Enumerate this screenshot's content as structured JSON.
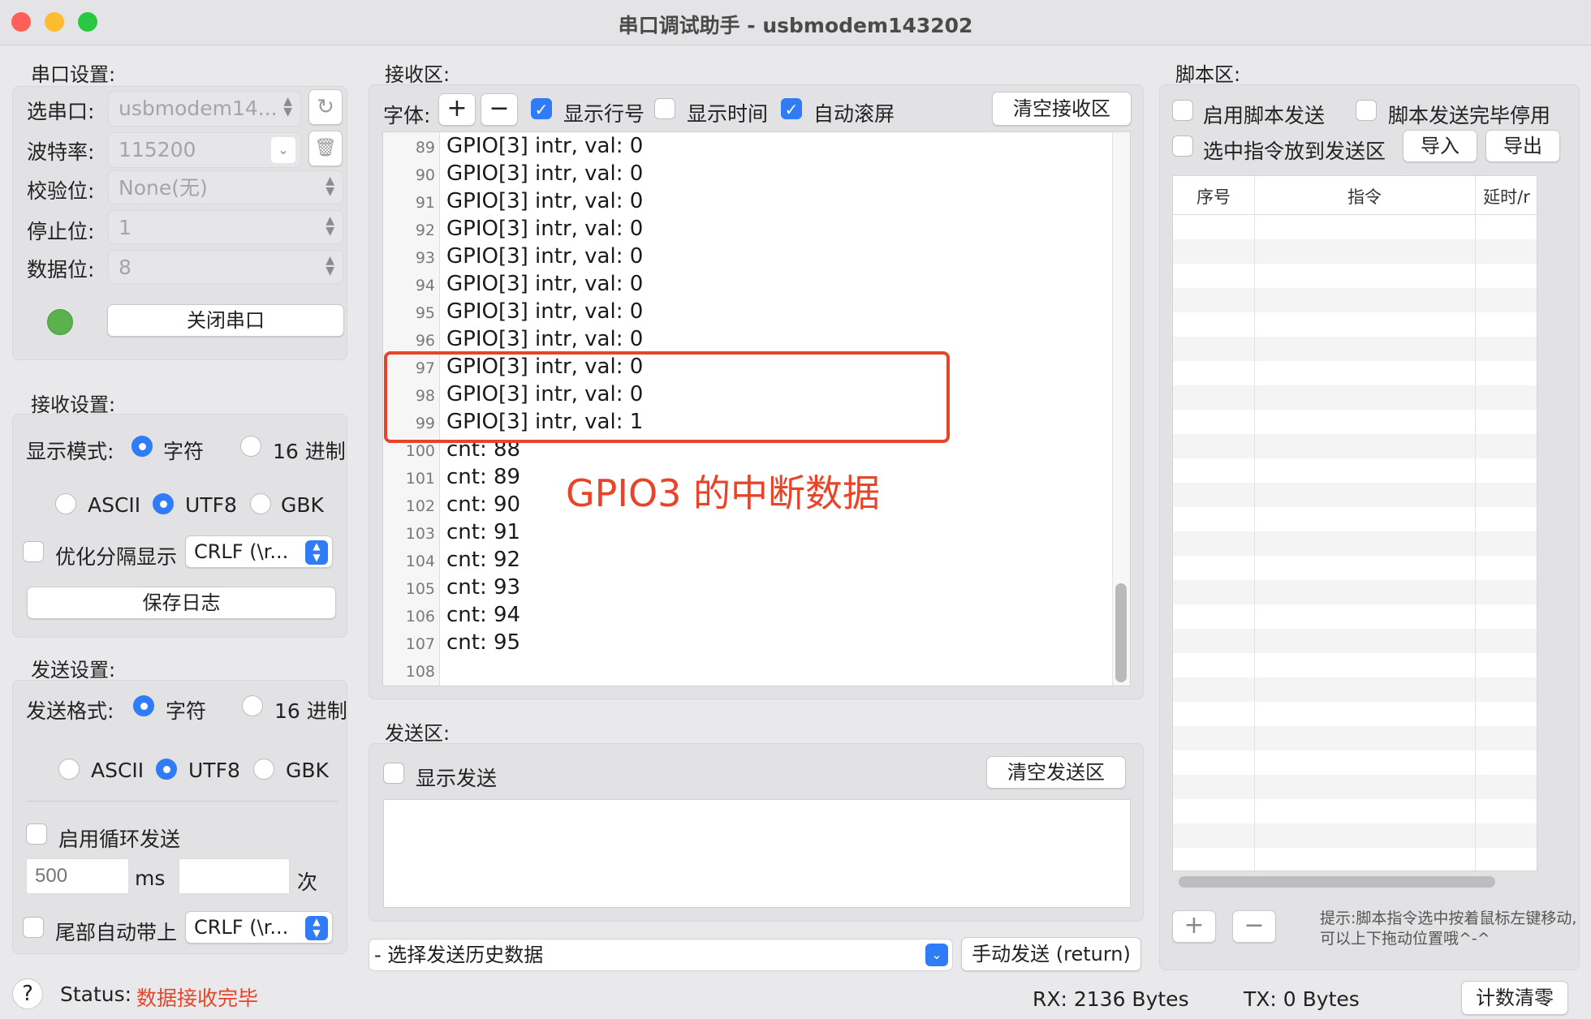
{
  "window": {
    "title": "串口调试助手 - usbmodem143202",
    "traffic_colors": {
      "close": "#fe5f57",
      "minimize": "#febc2e",
      "zoom": "#28c840"
    }
  },
  "serial_settings": {
    "title": "串口设置:",
    "port_label": "选串口:",
    "port_value": "usbmodem14...",
    "baud_label": "波特率:",
    "baud_value": "115200",
    "parity_label": "校验位:",
    "parity_value": "None(无)",
    "stop_label": "停止位:",
    "stop_value": "1",
    "data_label": "数据位:",
    "data_value": "8",
    "status_color": "#5bb14c",
    "toggle_button": "关闭串口"
  },
  "receive_settings": {
    "title": "接收设置:",
    "display_mode_label": "显示模式:",
    "mode_char": "字符",
    "mode_hex": "16 进制",
    "enc_ascii": "ASCII",
    "enc_utf8": "UTF8",
    "enc_gbk": "GBK",
    "optimize_label": "优化分隔显示",
    "line_ending": "CRLF (\\r...",
    "save_log": "保存日志"
  },
  "send_settings": {
    "title": "发送设置:",
    "format_label": "发送格式:",
    "mode_char": "字符",
    "mode_hex": "16 进制",
    "enc_ascii": "ASCII",
    "enc_utf8": "UTF8",
    "enc_gbk": "GBK",
    "loop_label": "启用循环发送",
    "interval_placeholder": "500",
    "interval_unit": "ms",
    "count_unit": "次",
    "tail_label": "尾部自动带上",
    "line_ending": "CRLF (\\r..."
  },
  "receive_area": {
    "title": "接收区:",
    "font_label": "字体:",
    "font_plus": "+",
    "font_minus": "−",
    "show_line_numbers": "显示行号",
    "show_time": "显示时间",
    "auto_scroll": "自动滚屏",
    "clear_button": "清空接收区",
    "lines": [
      {
        "n": "89",
        "t": "GPIO[3] intr, val: 0"
      },
      {
        "n": "90",
        "t": "GPIO[3] intr, val: 0"
      },
      {
        "n": "91",
        "t": "GPIO[3] intr, val: 0"
      },
      {
        "n": "92",
        "t": "GPIO[3] intr, val: 0"
      },
      {
        "n": "93",
        "t": "GPIO[3] intr, val: 0"
      },
      {
        "n": "94",
        "t": "GPIO[3] intr, val: 0"
      },
      {
        "n": "95",
        "t": "GPIO[3] intr, val: 0"
      },
      {
        "n": "96",
        "t": "GPIO[3] intr, val: 0"
      },
      {
        "n": "97",
        "t": "GPIO[3] intr, val: 0"
      },
      {
        "n": "98",
        "t": "GPIO[3] intr, val: 0"
      },
      {
        "n": "99",
        "t": "GPIO[3] intr, val: 1"
      },
      {
        "n": "100",
        "t": "cnt: 88"
      },
      {
        "n": "101",
        "t": "cnt: 89"
      },
      {
        "n": "102",
        "t": "cnt: 90"
      },
      {
        "n": "103",
        "t": "cnt: 91"
      },
      {
        "n": "104",
        "t": "cnt: 92"
      },
      {
        "n": "105",
        "t": "cnt: 93"
      },
      {
        "n": "106",
        "t": "cnt: 94"
      },
      {
        "n": "107",
        "t": "cnt: 95"
      },
      {
        "n": "108",
        "t": ""
      }
    ],
    "annotation": "GPIO3 的中断数据",
    "annotation_color": "#e84427"
  },
  "send_area": {
    "title": "发送区:",
    "show_send": "显示发送",
    "clear_button": "清空发送区",
    "history_placeholder": "- 选择发送历史数据",
    "send_button": "手动发送 (return)"
  },
  "script_area": {
    "title": "脚本区:",
    "enable_script": "启用脚本发送",
    "disable_after": "脚本发送完毕停用",
    "put_to_send": "选中指令放到发送区",
    "import": "导入",
    "export": "导出",
    "col_index": "序号",
    "col_command": "指令",
    "col_delay": "延时/r",
    "add": "+",
    "remove": "−",
    "hint": "提示:脚本指令选中按着鼠标左键移动,可以上下拖动位置哦^-^"
  },
  "status_bar": {
    "help": "?",
    "status_label": "Status:",
    "status_value": "数据接收完毕",
    "rx": "RX:  2136 Bytes",
    "tx": "TX: 0 Bytes",
    "reset_button": "计数清零"
  }
}
